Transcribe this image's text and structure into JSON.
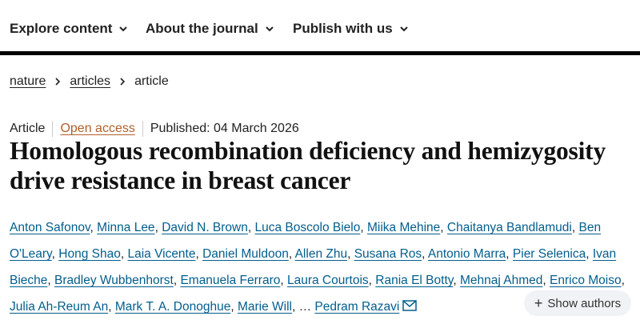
{
  "nav": {
    "items": [
      {
        "label": "Explore content"
      },
      {
        "label": "About the journal"
      },
      {
        "label": "Publish with us"
      }
    ]
  },
  "breadcrumb": {
    "items": [
      "nature",
      "articles",
      "article"
    ]
  },
  "meta": {
    "type": "Article",
    "access": "Open access",
    "published": "Published: 04 March 2026"
  },
  "title": "Homologous recombination deficiency and hemizygosity drive resistance in breast cancer",
  "authors": {
    "list": [
      "Anton Safonov",
      "Minna Lee",
      "David N. Brown",
      "Luca Boscolo Bielo",
      "Miika Mehine",
      "Chaitanya Bandlamudi",
      "Ben O'Leary",
      "Hong Shao",
      "Laia Vicente",
      "Daniel Muldoon",
      "Allen Zhu",
      "Susana Ros",
      "Antonio Marra",
      "Pier Selenica",
      "Ivan Bieche",
      "Bradley Wubbenhorst",
      "Emanuela Ferraro",
      "Laura Courtois",
      "Rania El Botty",
      "Mehnaj Ahmed",
      "Enrico Moiso",
      "Julia Ah-Reum An",
      "Mark T. A. Donoghue",
      "Marie Will"
    ],
    "ellipsis": "…",
    "last": "Pedram Razavi",
    "show_authors_label": "Show authors"
  },
  "colors": {
    "link": "#025e8d",
    "open_access": "#b0602a",
    "nav_rule": "#000000"
  }
}
